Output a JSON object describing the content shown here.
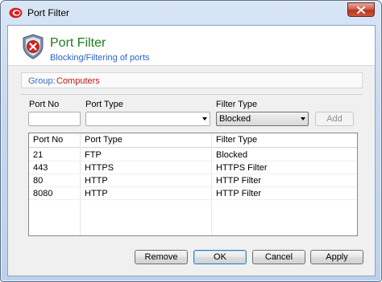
{
  "window": {
    "title": "Port Filter"
  },
  "header": {
    "title": "Port Filter",
    "subtitle": "Blocking/Filtering of ports"
  },
  "group": {
    "label": "Group:",
    "value": "Computers"
  },
  "form": {
    "port_no_label": "Port No",
    "port_no_value": "",
    "port_type_label": "Port Type",
    "port_type_value": "",
    "filter_type_label": "Filter Type",
    "filter_type_value": "Blocked",
    "add_label": "Add"
  },
  "table": {
    "columns": [
      "Port No",
      "Port Type",
      "Filter Type"
    ],
    "rows": [
      [
        "21",
        "FTP",
        "Blocked"
      ],
      [
        "443",
        "HTTPS",
        "HTTPS Filter"
      ],
      [
        "80",
        "HTTP",
        "HTTP Filter"
      ],
      [
        "8080",
        "HTTP",
        "HTTP Filter"
      ]
    ]
  },
  "buttons": {
    "remove": "Remove",
    "ok": "OK",
    "cancel": "Cancel",
    "apply": "Apply"
  },
  "colors": {
    "header_title": "#1b7c1b",
    "subtitle": "#2a63c9",
    "group_value": "#c01818"
  }
}
